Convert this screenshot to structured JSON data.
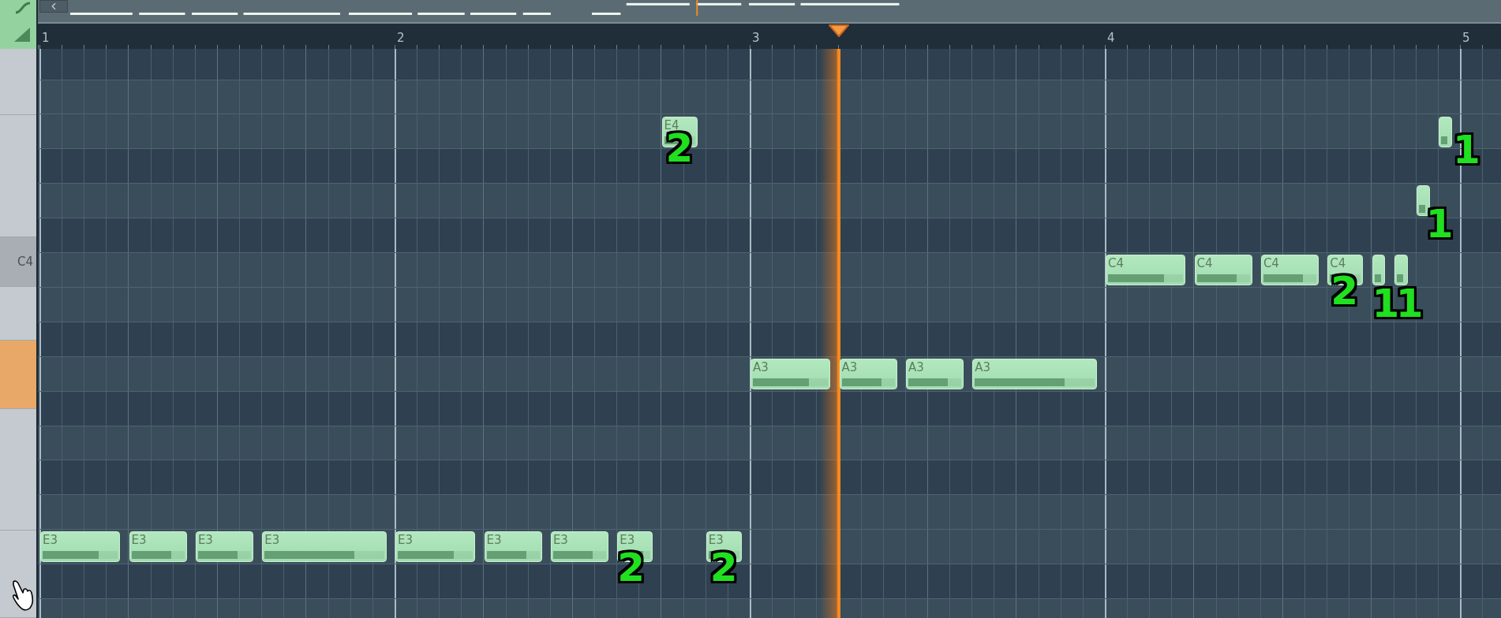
{
  "ruler": {
    "bars": [
      "1",
      "2",
      "3",
      "4",
      "5"
    ]
  },
  "keyboard": [
    {
      "root": false,
      "playing": false
    },
    {
      "root": false,
      "playing": false
    },
    {
      "label": "C4",
      "root": true,
      "playing": false
    },
    {
      "root": false,
      "playing": false
    },
    {
      "root": false,
      "playing": true
    },
    {
      "root": false,
      "playing": false
    },
    {
      "root": false,
      "playing": false
    }
  ],
  "notes": [
    {
      "label": "E4",
      "level": 0.75,
      "finger": "2"
    },
    {
      "finger": "1"
    },
    {
      "finger": "1"
    },
    {
      "label": "C4",
      "level": 0.75
    },
    {
      "label": "C4",
      "level": 0.75
    },
    {
      "label": "C4",
      "level": 0.75
    },
    {
      "label": "C4",
      "level": 0.75,
      "finger": "2"
    },
    {
      "finger": "1"
    },
    {
      "finger": "1"
    },
    {
      "label": "A3",
      "level": 0.75
    },
    {
      "label": "A3",
      "level": 0.75
    },
    {
      "label": "A3",
      "level": 0.75
    },
    {
      "label": "A3",
      "level": 0.75
    },
    {
      "label": "E3",
      "level": 0.75
    },
    {
      "label": "E3",
      "level": 0.75
    },
    {
      "label": "E3",
      "level": 0.75
    },
    {
      "label": "E3",
      "level": 0.75
    },
    {
      "label": "E3",
      "level": 0.75
    },
    {
      "label": "E3",
      "level": 0.75
    },
    {
      "label": "E3",
      "level": 0.75
    },
    {
      "label": "E3",
      "level": 0.75,
      "finger": "2"
    },
    {
      "label": "E3",
      "level": 0.75,
      "finger": "2"
    }
  ]
}
